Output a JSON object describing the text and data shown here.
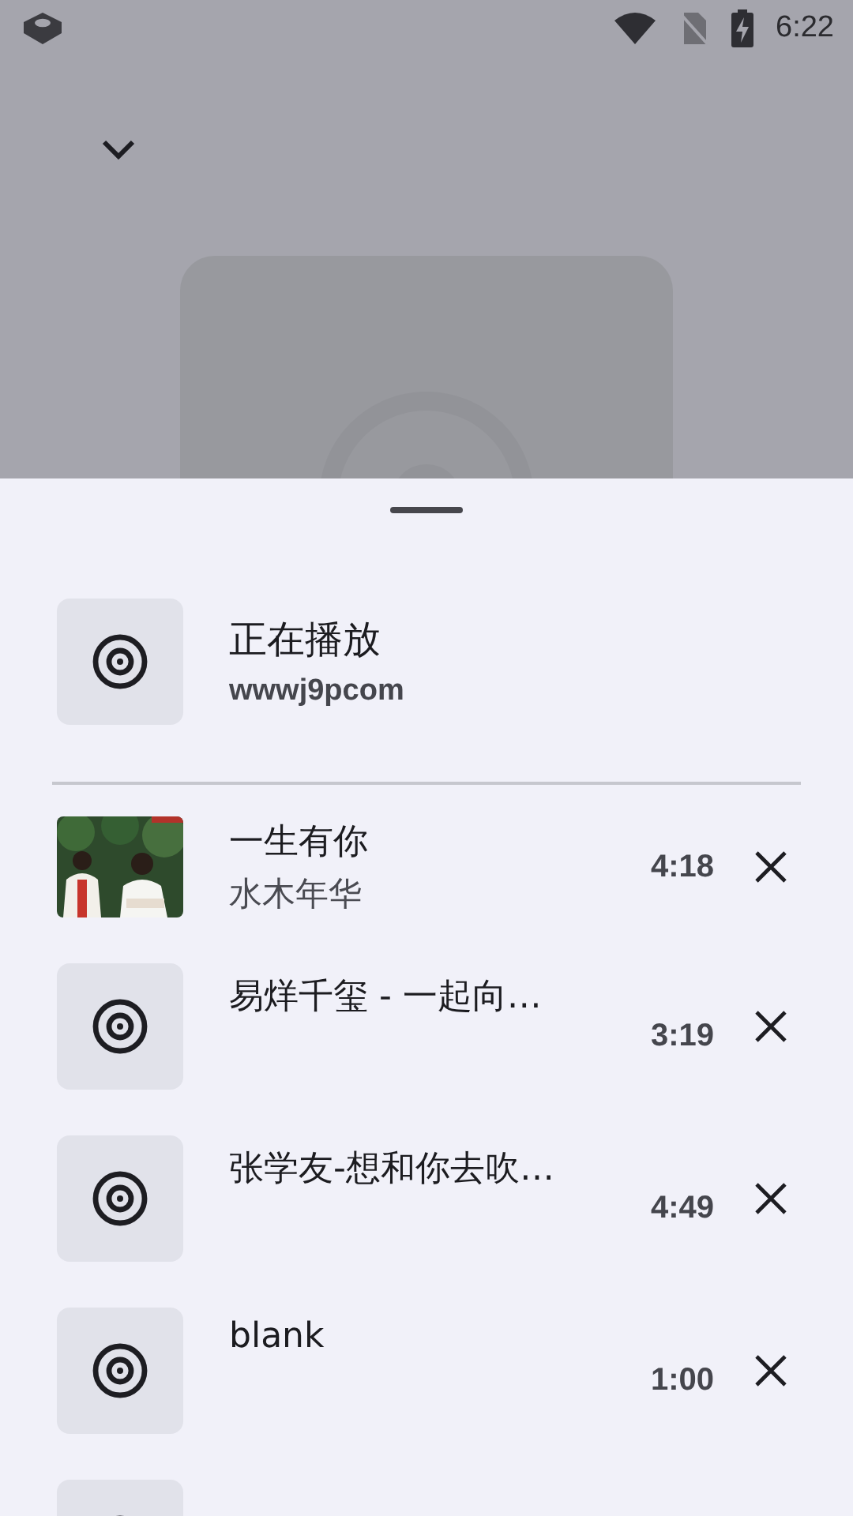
{
  "status_bar": {
    "time": "6:22"
  },
  "now_playing": {
    "title": "正在播放",
    "subtitle": "wwwj9pcom"
  },
  "queue": [
    {
      "kind": "picture",
      "title": "一生有你",
      "artist": "水木年华",
      "duration": "4:18"
    },
    {
      "kind": "disc",
      "title": "易烊千玺 - 一起向…",
      "duration": "3:19"
    },
    {
      "kind": "disc",
      "title": "张学友-想和你去吹…",
      "duration": "4:49"
    },
    {
      "kind": "disc",
      "title": "blank",
      "duration": "1:00"
    },
    {
      "kind": "disc"
    }
  ]
}
